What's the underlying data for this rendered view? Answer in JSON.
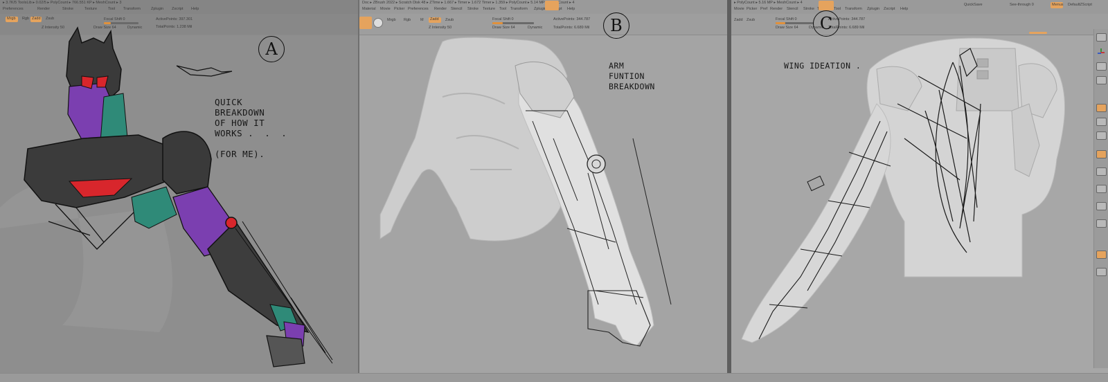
{
  "panels": {
    "a": {
      "menubar_status": "▸ 3.7K/5 ToolsLib ▸ 0.02/5 ▸ PolyCount ▸ 766.551 KP ▸ MeshCount ▸ 3",
      "menu_items": [
        "Preferences",
        "Render",
        "Stroke",
        "Texture",
        "Tool",
        "Transform",
        "Zplugin",
        "Zscript",
        "Help"
      ],
      "toolbar": {
        "buttons": [
          "Mrgb",
          "Rgb",
          "M",
          "Zadd",
          "Zsub"
        ],
        "focal_shift": "Focal Shift 0",
        "draw_size": "Draw Size 64",
        "z_intensity": "Z Intensity 50",
        "active_points": "ActivePoints: 397.301",
        "total_points": "TotalPoints: 1.238 Mil",
        "dynamic": "Dynamic"
      },
      "annotation_letter": "A",
      "annotation_text": "QUICK\nBREAKDOWN\nOF HOW IT\nWORKS .  .  .\n\n(FOR ME)."
    },
    "b": {
      "menubar_status": "Doc ▸ ZBrush 2022 ▸ Scratch Disk 48 ▸ ZTime ▸ 1.667 ▸ Timer ▸ 1.672 Timer ▸ 1.359 ▸ PolyCount ▸ 5.14 MP ▸ MeshCount ▸ 4",
      "menu_items": [
        "Material",
        "Movie",
        "Picker",
        "Preferences",
        "Render",
        "Stencil",
        "Stroke",
        "Texture",
        "Tool",
        "Transform",
        "Zplugin",
        "Zscript",
        "Help"
      ],
      "toolbar": {
        "buttons": [
          "Mrgb",
          "Rgb",
          "M",
          "Zadd",
          "Zsub"
        ],
        "focal_shift": "Focal Shift 0",
        "draw_size": "Draw Size 64",
        "z_intensity": "Z Intensity 50",
        "active_points": "ActivePoints: 344.787",
        "total_points": "TotalPoints: 6.689 Mil",
        "dynamic": "Dynamic"
      },
      "annotation_letter": "B",
      "annotation_text": "ARM\nFUNTION\nBREAKDOWN"
    },
    "c": {
      "menubar_status": "▸ PolyCount ▸ 5.16 MP ▸ MeshCount ▸ 4",
      "menu_items": [
        "Movie",
        "Picker",
        "Pref",
        "Render",
        "Stencil",
        "Stroke",
        "Texture",
        "Tool",
        "Transform",
        "Zplugin",
        "Zscript",
        "Help"
      ],
      "quicksave": "QuickSave",
      "see_through": "See-through 0",
      "menus_label": "Menus",
      "default_script": "DefaultZScript",
      "toolbar": {
        "buttons": [
          "Zadd",
          "Zsub"
        ],
        "focal_shift": "Focal Shift 0",
        "draw_size": "Draw Size 64",
        "dynamic": "Dynamic",
        "active_points": "ActivePoints: 344.787",
        "total_points": "TotalPoints: 6.689 Mil"
      },
      "annotation_letter": "C",
      "annotation_text": "WING IDEATION ."
    }
  },
  "colors": {
    "accent_orange": "#e5a35d",
    "sketch_black": "#1a1a1a",
    "red": "#d8262c",
    "purple": "#7b3fb0",
    "teal": "#2f8a78"
  }
}
